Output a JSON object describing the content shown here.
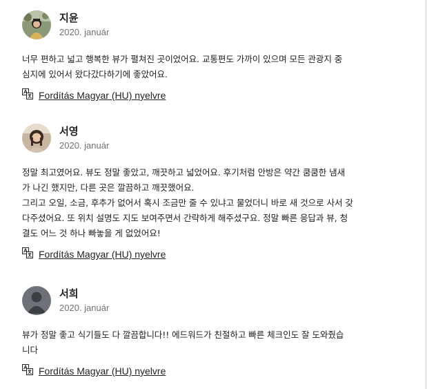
{
  "reviews": [
    {
      "name": "지윤",
      "date": "2020. január",
      "text": "너무 편하고 넓고 행복한 뷰가 펼쳐진 곳이었어요. 교통편도 가까이 있으며 모든 관광지 중\n심지에 있어서 왔다갔다하기에 좋았어요.",
      "translate_label": "Fordítás Magyar (HU) nyelvre",
      "avatar": "photo"
    },
    {
      "name": "서영",
      "date": "2020. január",
      "text": "정말 최고였어요. 뷰도 정말 좋았고, 깨끗하고 넓었어요. 후기처럼 안방은 약간 쿰쿰한 냄새\n가 나긴 했지만, 다른 곳은 깔끔하고 깨끗했어요.\n그리고 오일, 소금, 후추가 없어서 혹시 조금만 줄 수 있냐고 물었더니 바로 새 것으로 사서 갖\n다주셨어요. 또 위치 설명도 지도 보여주면서 간략하게 해주셨구요. 정말 빠른 응답과 뷰, 청\n결도 어느 것 하나 빠놓을 게 없었어요!",
      "translate_label": "Fordítás Magyar (HU) nyelvre",
      "avatar": "photo"
    },
    {
      "name": "서희",
      "date": "2020. január",
      "text": "뷰가 정말 좋고 식기들도 다 깔끔합니다!! 에드워드가 친절하고 빠른 체크인도 잘 도와줬습\n니다",
      "translate_label": "Fordítás Magyar (HU) nyelvre",
      "avatar": "default-user"
    }
  ],
  "colors": {
    "text": "#222222",
    "muted": "#717171",
    "default_avatar": "#6e7177"
  },
  "icons": {
    "translate": "translate-icon"
  }
}
